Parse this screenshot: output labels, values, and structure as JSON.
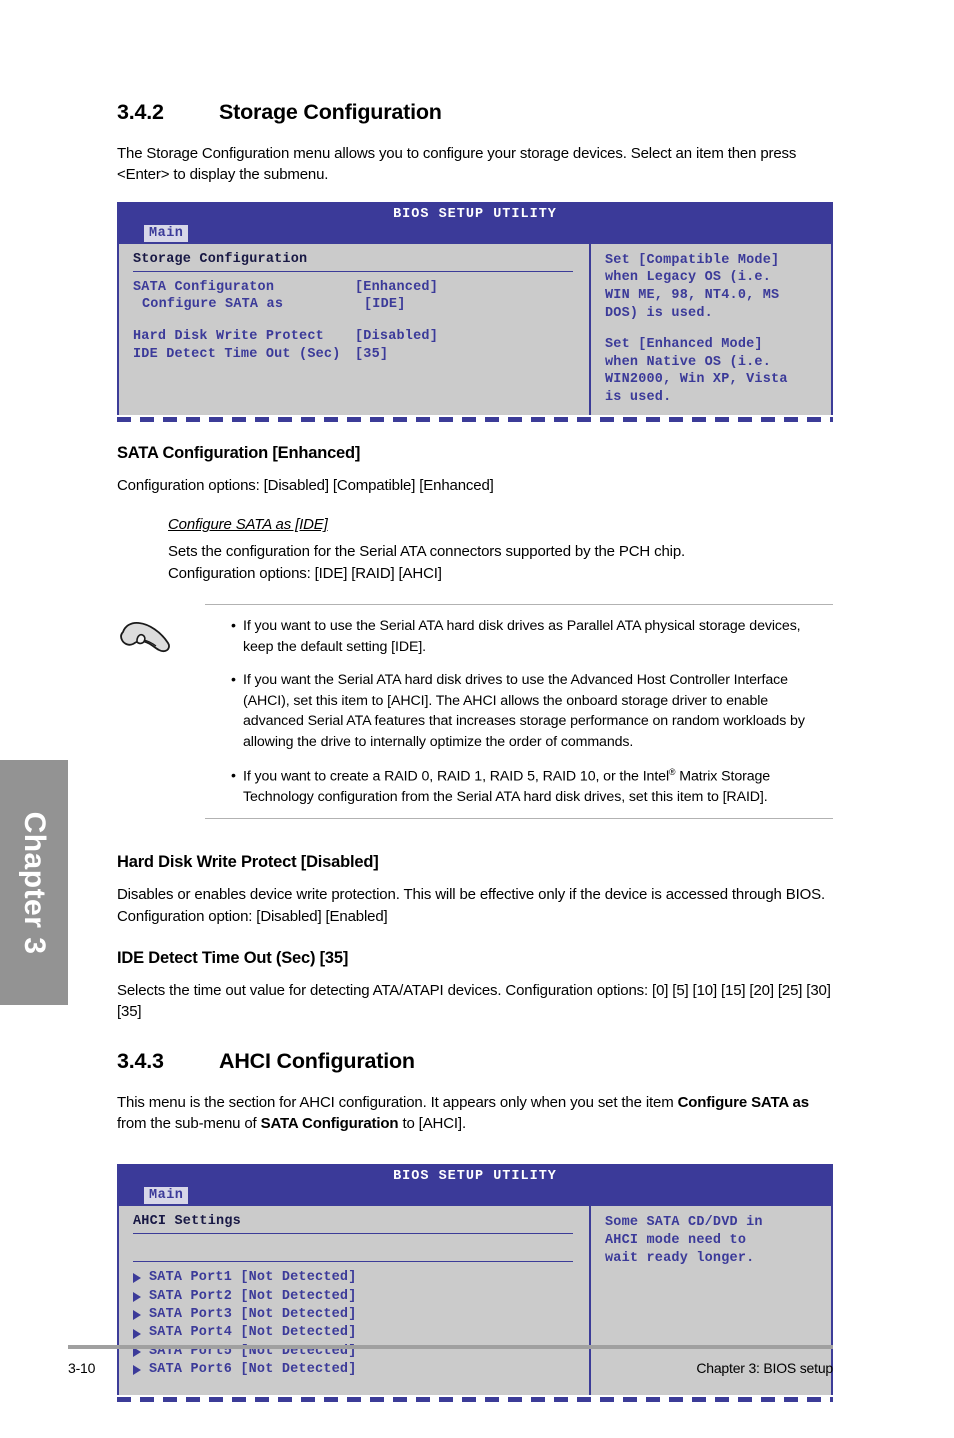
{
  "sidebar": {
    "chapter_label": "Chapter 3"
  },
  "section_342": {
    "number": "3.4.2",
    "title": "Storage Configuration",
    "intro": "The Storage Configuration menu allows you to configure your storage devices. Select an item then press <Enter> to display the submenu."
  },
  "bios_storage": {
    "header_title": "BIOS SETUP UTILITY",
    "tab_label": "Main",
    "section_title": "Storage Configuration",
    "rows": [
      {
        "label": "SATA Configuraton",
        "value": "[Enhanced]",
        "indent": false
      },
      {
        "label": "Configure SATA as",
        "value": "[IDE]",
        "indent": true
      },
      {
        "label": "",
        "value": "",
        "indent": false
      },
      {
        "label": "Hard Disk Write Protect",
        "value": "[Disabled]",
        "indent": false
      },
      {
        "label": "IDE Detect Time Out (Sec)",
        "value": "[35]",
        "indent": false
      }
    ],
    "help_paragraphs": [
      "Set [Compatible Mode]\nwhen Legacy OS (i.e.\nWIN ME, 98, NT4.0, MS\nDOS) is used.",
      "Set [Enhanced Mode]\nwhen Native OS (i.e.\nWIN2000, Win XP, Vista\nis used."
    ]
  },
  "sata_config": {
    "heading": "SATA Configuration [Enhanced]",
    "options_line": "Configuration options: [Disabled] [Compatible] [Enhanced]",
    "sub_heading": "Configure SATA as [IDE]",
    "sub_desc": "Sets the configuration for the Serial ATA connectors supported by the PCH chip.",
    "sub_options": "Configuration options: [IDE] [RAID] [AHCI]"
  },
  "note": {
    "icon_name": "pointing-hand-icon",
    "bullet_char": "•",
    "items": [
      "If you want to use the Serial ATA hard disk drives as Parallel ATA physical storage devices, keep the default setting [IDE].",
      "If you want the Serial ATA hard disk drives to use the Advanced Host Controller Interface (AHCI), set this item to [AHCI]. The AHCI allows the onboard storage driver to enable advanced Serial ATA features that increases storage performance on random workloads by allowing the drive to internally optimize the order of commands."
    ],
    "item3_part1": "If you want to create a RAID 0, RAID 1, RAID 5, RAID 10, or the Intel",
    "item3_sup": "®",
    "item3_part2": " Matrix Storage Technology configuration from the Serial ATA hard disk drives, set this item to [RAID]."
  },
  "hard_disk_write_protect": {
    "heading": "Hard Disk Write Protect [Disabled]",
    "desc": "Disables or enables device write protection. This will be effective only if the device is accessed through BIOS. Configuration option: [Disabled] [Enabled]"
  },
  "ide_detect_time_out": {
    "heading": "IDE Detect Time Out (Sec) [35]",
    "desc": "Selects the time out value for detecting ATA/ATAPI devices. Configuration options: [0] [5] [10] [15] [20] [25] [30] [35]"
  },
  "section_343": {
    "number": "3.4.3",
    "title": "AHCI Configuration",
    "intro_part1": "This menu is the section for AHCI configuration. It appears only when you set the item ",
    "intro_bold1": "Configure SATA as",
    "intro_part2": " from the sub-menu of ",
    "intro_bold2": "SATA Configuration",
    "intro_part3": " to [AHCI]."
  },
  "bios_ahci": {
    "header_title": "BIOS SETUP UTILITY",
    "tab_label": "Main",
    "section_title": "AHCI Settings",
    "ports": [
      "SATA Port1 [Not Detected]",
      "SATA Port2 [Not Detected]",
      "SATA Port3 [Not Detected]",
      "SATA Port4 [Not Detected]",
      "SATA Port5 [Not Detected]",
      "SATA Port6 [Not Detected]"
    ],
    "help_paragraphs": [
      "Some SATA CD/DVD in\nAHCI mode need to\nwait ready longer."
    ]
  },
  "footer": {
    "page_number": "3-10",
    "chapter_text": "Chapter 3: BIOS setup"
  },
  "colors": {
    "bios_header_blue": "#3b3a99",
    "bios_body_gray": "#cbcbcb",
    "bios_border_blue": "#3c3c98",
    "chapter_tab_gray": "#939393",
    "footer_rule_gray": "#a0a0a0"
  }
}
